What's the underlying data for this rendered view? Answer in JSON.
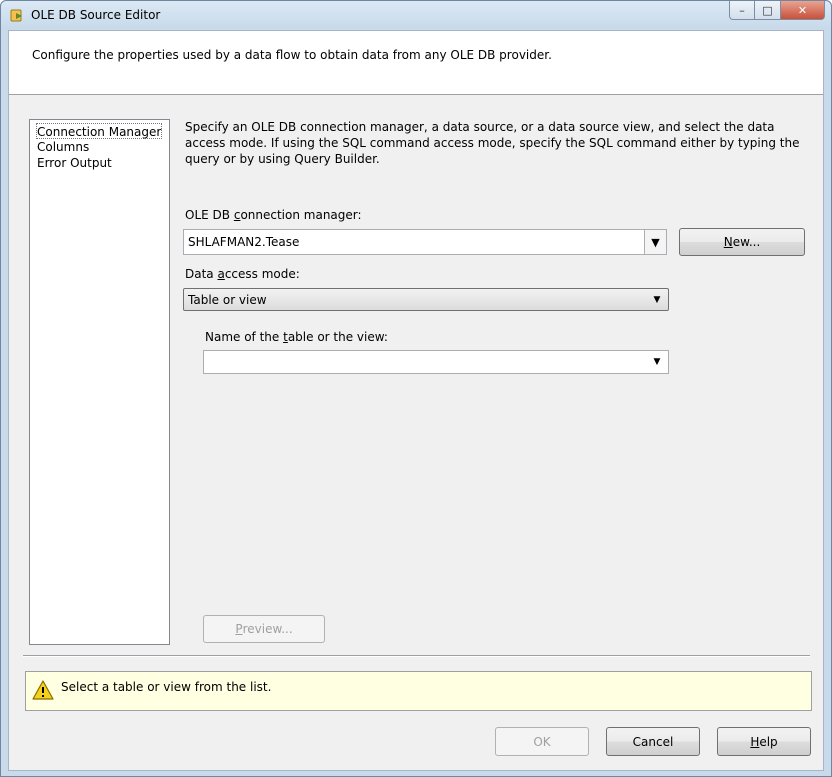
{
  "window": {
    "title": "OLE DB Source Editor",
    "controls": {
      "minimize": "–",
      "maximize": "□",
      "close": "✕"
    }
  },
  "header": {
    "description": "Configure the properties used by a data flow to obtain data from any OLE DB provider."
  },
  "nav": {
    "items": [
      {
        "label": "Connection Manager",
        "selected": true
      },
      {
        "label": "Columns",
        "selected": false
      },
      {
        "label": "Error Output",
        "selected": false
      }
    ]
  },
  "main": {
    "description": "Specify an OLE DB connection manager, a data source, or a data source view, and select the data access mode. If using the SQL command access mode, specify the SQL command either by typing the query or by using Query Builder.",
    "connection_manager": {
      "label_pre": "OLE DB ",
      "label_u": "c",
      "label_post": "onnection manager:",
      "value": "SHLAFMAN2.Tease",
      "new_pre": "",
      "new_u": "N",
      "new_post": "ew..."
    },
    "access_mode": {
      "label_pre": "Data ",
      "label_u": "a",
      "label_post": "ccess mode:",
      "value": "Table or view"
    },
    "table": {
      "label_pre": "Name of the ",
      "label_u": "t",
      "label_post": "able or the view:",
      "value": ""
    },
    "preview": {
      "pre": "",
      "u": "P",
      "post": "review..."
    }
  },
  "status": {
    "message": "Select a table or view from the list."
  },
  "buttons": {
    "ok": "OK",
    "cancel": "Cancel",
    "help_u": "H",
    "help_post": "elp"
  },
  "icons": {
    "title": "ole-db-source-icon",
    "warning": "warning-triangle-icon",
    "dropdown": "chevron-down-icon"
  },
  "colors": {
    "warning_bg": "#ffffe1",
    "chrome": "#c9daea",
    "close": "#c7503a"
  }
}
